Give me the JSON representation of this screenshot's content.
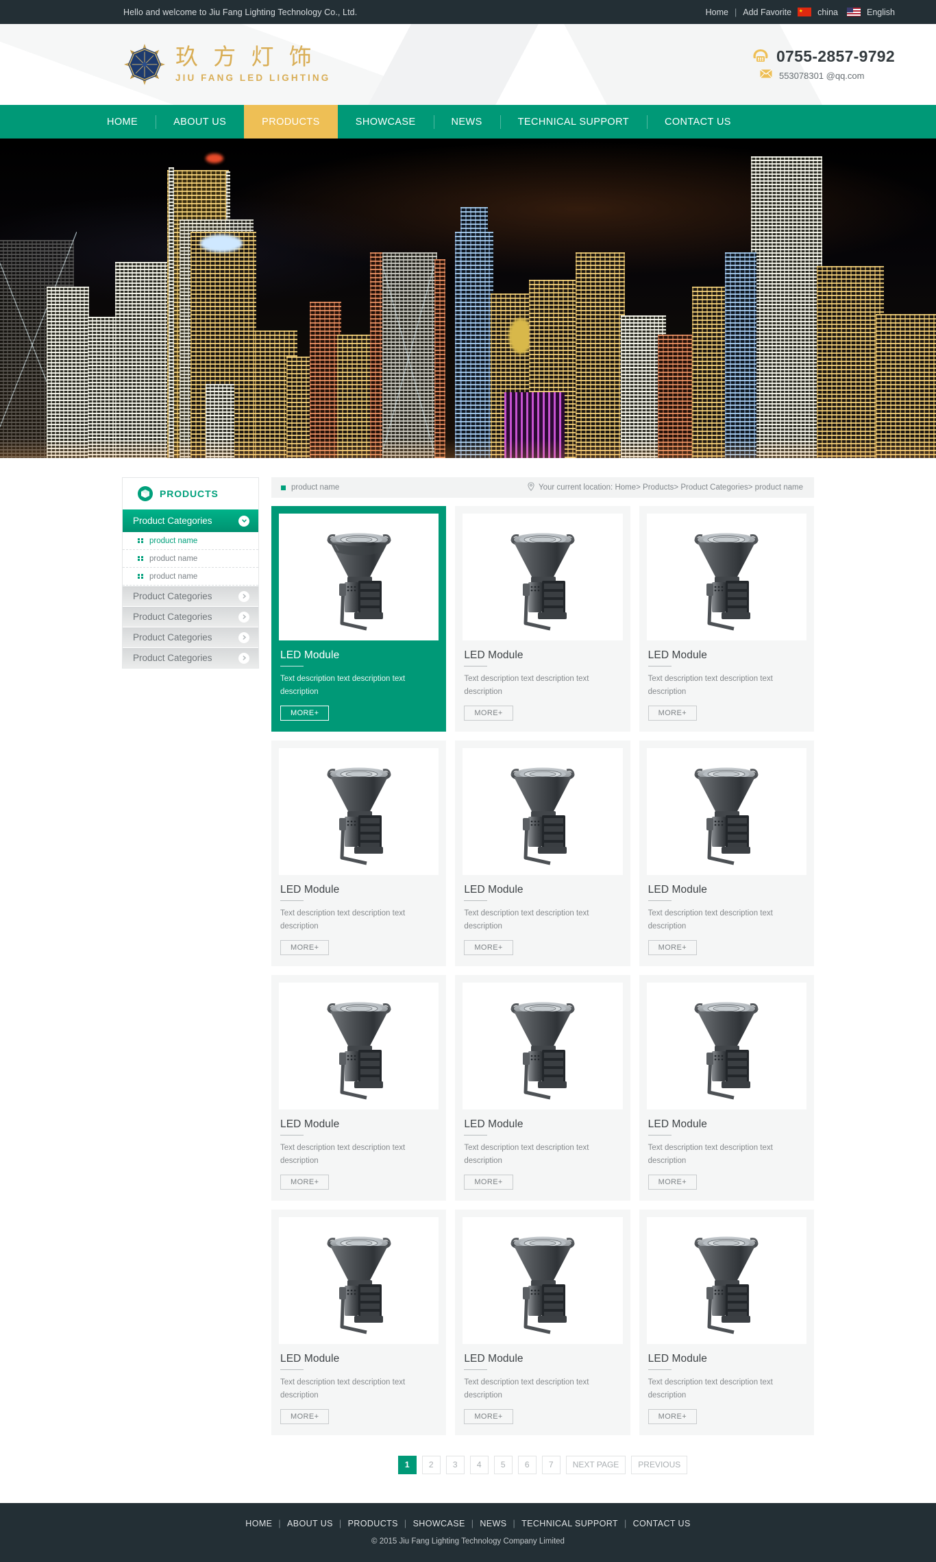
{
  "topbar": {
    "welcome": "Hello and welcome to Jiu Fang Lighting Technology Co., Ltd.",
    "home": "Home",
    "separator": "|",
    "add_favorite": "Add Favorite",
    "lang_cn": "china",
    "lang_en": "English"
  },
  "header": {
    "logo_cn": "玖 方 灯 饰",
    "logo_en": "JIU FANG LED LIGHTING",
    "phone": "0755-2857-9792",
    "email": "553078301 @qq.com"
  },
  "nav": {
    "items": [
      {
        "label": "HOME",
        "active": false
      },
      {
        "label": "ABOUT US",
        "active": false
      },
      {
        "label": "PRODUCTS",
        "active": true
      },
      {
        "label": "SHOWCASE",
        "active": false
      },
      {
        "label": "NEWS",
        "active": false
      },
      {
        "label": "TECHNICAL SUPPORT",
        "active": false
      },
      {
        "label": "CONTACT US",
        "active": false
      }
    ]
  },
  "sidebar": {
    "title": "PRODUCTS",
    "active_category": "Product Categories",
    "sub_items": [
      {
        "label": "product name",
        "active": true
      },
      {
        "label": "product name",
        "active": false
      },
      {
        "label": "product name",
        "active": false
      }
    ],
    "categories": [
      "Product Categories",
      "Product Categories",
      "Product Categories",
      "Product Categories"
    ]
  },
  "breadcrumb": {
    "page_label": "product name",
    "location": "Your current location: Home> Products> Product Categories> product name"
  },
  "products": [
    {
      "title": "LED Module",
      "desc": "Text description text description text description",
      "more": "MORE+",
      "featured": true
    },
    {
      "title": "LED Module",
      "desc": "Text description text description text description",
      "more": "MORE+",
      "featured": false
    },
    {
      "title": "LED Module",
      "desc": "Text description text description text description",
      "more": "MORE+",
      "featured": false
    },
    {
      "title": "LED Module",
      "desc": "Text description text description text description",
      "more": "MORE+",
      "featured": false
    },
    {
      "title": "LED Module",
      "desc": "Text description text description text description",
      "more": "MORE+",
      "featured": false
    },
    {
      "title": "LED Module",
      "desc": "Text description text description text description",
      "more": "MORE+",
      "featured": false
    },
    {
      "title": "LED Module",
      "desc": "Text description text description text description",
      "more": "MORE+",
      "featured": false
    },
    {
      "title": "LED Module",
      "desc": "Text description text description text description",
      "more": "MORE+",
      "featured": false
    },
    {
      "title": "LED Module",
      "desc": "Text description text description text description",
      "more": "MORE+",
      "featured": false
    },
    {
      "title": "LED Module",
      "desc": "Text description text description text description",
      "more": "MORE+",
      "featured": false
    },
    {
      "title": "LED Module",
      "desc": "Text description text description text description",
      "more": "MORE+",
      "featured": false
    },
    {
      "title": "LED Module",
      "desc": "Text description text description text description",
      "more": "MORE+",
      "featured": false
    }
  ],
  "pagination": {
    "pages": [
      "1",
      "2",
      "3",
      "4",
      "5",
      "6",
      "7"
    ],
    "current": "1",
    "next_label": "NEXT PAGE",
    "prev_label": "PREVIOUS"
  },
  "footer": {
    "links": [
      "HOME",
      "ABOUT US",
      "PRODUCTS",
      "SHOWCASE",
      "NEWS",
      "TECHNICAL SUPPORT",
      "CONTACT US"
    ],
    "separator": "|",
    "copyright": "© 2015 Jiu Fang Lighting Technology Company Limited"
  },
  "colors": {
    "brand_green": "#009977",
    "accent_gold": "#eebf55",
    "dark": "#232f35",
    "logo_gold": "#d9ae56"
  }
}
